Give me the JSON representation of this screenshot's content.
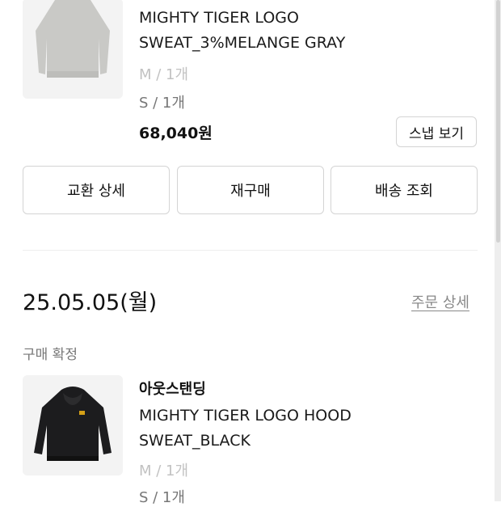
{
  "order_top": {
    "product_name_line1": "MIGHTY TIGER LOGO",
    "product_name_line2": "SWEAT_3%MELANGE GRAY",
    "options": [
      "M / 1개",
      "S / 1개"
    ],
    "price": "68,040원",
    "snap_button": "스냅 보기",
    "thumbnail_icon": "gray-sweatshirt-image",
    "actions": [
      "교환 상세",
      "재구매",
      "배송 조회"
    ]
  },
  "order_bottom": {
    "date": "25.05.05(월)",
    "order_detail_link": "주문 상세",
    "status": "구매 확정",
    "brand": "아웃스탠딩",
    "product_name_line1": "MIGHTY TIGER LOGO HOOD",
    "product_name_line2": "SWEAT_BLACK",
    "options": [
      "M / 1개",
      "S / 1개"
    ],
    "thumbnail_icon": "black-hoodie-image"
  },
  "colors": {
    "accent_text": "#111111",
    "muted_text": "#777777",
    "border": "#d4d4d4"
  }
}
